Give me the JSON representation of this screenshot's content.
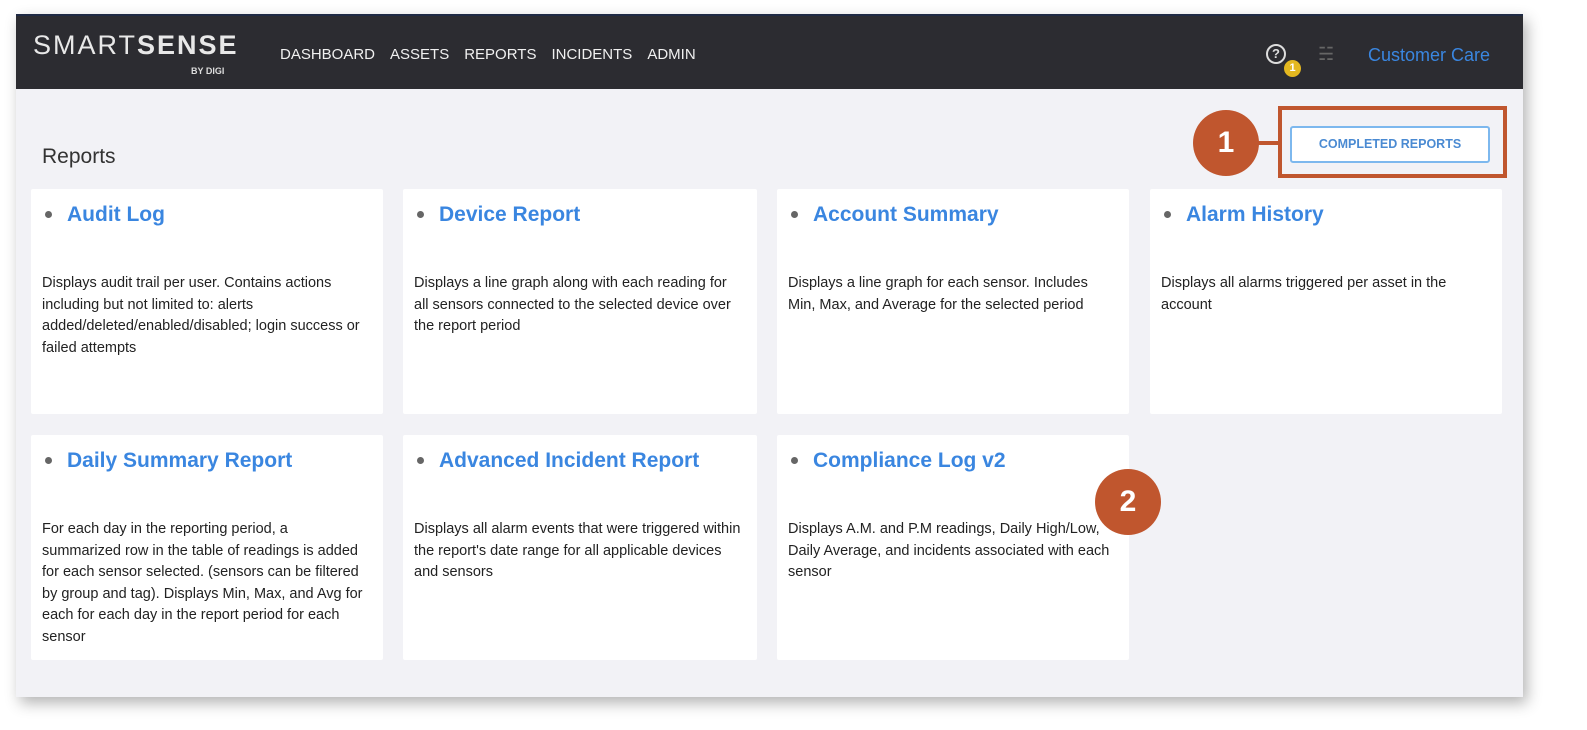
{
  "header": {
    "logo_light": "SMART",
    "logo_bold": "SENSE",
    "logo_sub": "BY DIGI",
    "nav": [
      "DASHBOARD",
      "ASSETS",
      "REPORTS",
      "INCIDENTS",
      "ADMIN"
    ],
    "help_badge": "1",
    "user": "Customer Care"
  },
  "page": {
    "title": "Reports",
    "completed_button": "COMPLETED REPORTS"
  },
  "cards": [
    {
      "title": "Audit Log",
      "desc": "Displays audit trail per user. Contains actions including but not limited to: alerts added/deleted/enabled/disabled; login success or failed attempts"
    },
    {
      "title": "Device Report",
      "desc": "Displays a line graph along with each reading for all sensors connected to the selected device over the report period"
    },
    {
      "title": "Account Summary",
      "desc": "Displays a line graph for each sensor. Includes Min, Max, and Average for the selected period"
    },
    {
      "title": "Alarm History",
      "desc": "Displays all alarms triggered per asset in the account"
    },
    {
      "title": "Daily Summary Report",
      "desc": "For each day in the reporting period, a summarized row in the table of readings is added for each sensor selected. (sensors can be filtered by group and tag). Displays Min, Max, and Avg for each for each day in the report period for each sensor"
    },
    {
      "title": "Advanced Incident Report",
      "desc": "Displays all alarm events that were triggered within the report's date range for all applicable devices and sensors"
    },
    {
      "title": "Compliance Log v2",
      "desc": "Displays A.M. and P.M readings, Daily High/Low, Daily Average, and incidents associated with each sensor"
    }
  ],
  "annotations": [
    "1",
    "2"
  ],
  "colors": {
    "accent": "#3a86e0",
    "annotation": "#c0562e",
    "header": "#2c2c31"
  }
}
